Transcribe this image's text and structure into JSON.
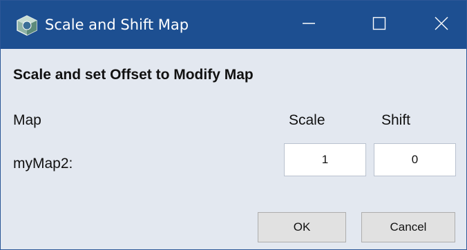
{
  "window": {
    "title": "Scale and Shift Map",
    "app_icon": "cube-app-icon",
    "controls": [
      "minimize-icon",
      "maximize-icon",
      "close-icon"
    ]
  },
  "dialog": {
    "heading": "Scale and set Offset to Modify Map",
    "columns": {
      "map": "Map",
      "scale": "Scale",
      "shift": "Shift"
    },
    "rows": [
      {
        "name": "myMap2:",
        "scale": "1",
        "shift": "0"
      }
    ]
  },
  "buttons": {
    "ok": "OK",
    "cancel": "Cancel"
  },
  "colors": {
    "titlebar": "#1d4f91",
    "background": "#e3e8f0",
    "button": "#e1e1e1"
  }
}
